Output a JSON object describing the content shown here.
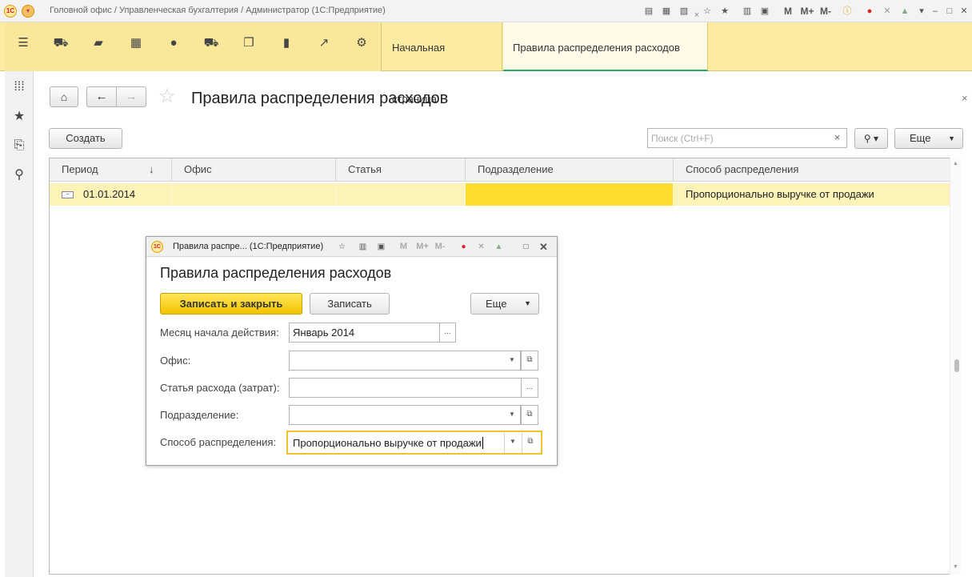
{
  "window": {
    "title": "Головной офис / Управленческая бухгалтерия / Администратор  (1С:Предприятие)",
    "controls": {
      "m": "M",
      "m_plus": "M+",
      "m_minus": "M-"
    }
  },
  "tabs": {
    "home_label": "Начальная страница",
    "active_label": "Правила распределения расходов",
    "close": "×"
  },
  "list_form": {
    "title": "Правила распределения расходов",
    "close": "×",
    "create_button": "Создать",
    "search_placeholder": "Поиск (Ctrl+F)",
    "search_clear": "×",
    "more_button": "Еще",
    "columns": [
      "Период",
      "Офис",
      "Статья",
      "Подразделение",
      "Способ распределения"
    ],
    "sort_indicator": "↓",
    "rows": [
      {
        "period": "01.01.2014",
        "office": "",
        "article": "",
        "department": "",
        "method": "Пропорционально выручке от продажи"
      }
    ]
  },
  "dialog": {
    "window_title": "Правила распре...  (1С:Предприятие)",
    "m": "M",
    "m_plus": "M+",
    "m_minus": "M-",
    "heading": "Правила распределения расходов",
    "save_close_button": "Записать и закрыть",
    "save_button": "Записать",
    "more_button": "Еще",
    "fields": {
      "month_label": "Месяц начала действия:",
      "month_value": "Январь 2014",
      "office_label": "Офис:",
      "office_value": "",
      "article_label": "Статья расхода (затрат):",
      "article_value": "",
      "department_label": "Подразделение:",
      "department_value": "",
      "method_label": "Способ распределения:",
      "method_value": "Пропорционально выручке от продажи"
    },
    "ellipsis": "..."
  }
}
